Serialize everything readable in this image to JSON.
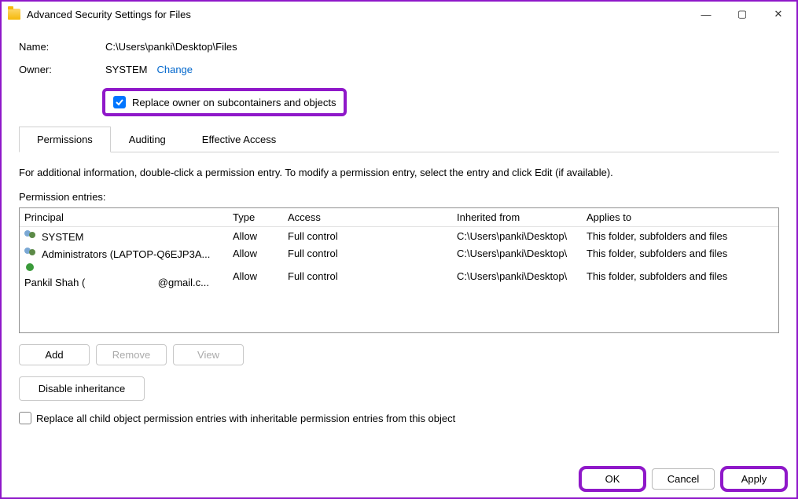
{
  "window": {
    "title": "Advanced Security Settings for Files"
  },
  "info": {
    "name_label": "Name:",
    "name_value": "C:\\Users\\panki\\Desktop\\Files",
    "owner_label": "Owner:",
    "owner_value": "SYSTEM",
    "change_link": "Change",
    "replace_owner_label": "Replace owner on subcontainers and objects"
  },
  "tabs": {
    "permissions": "Permissions",
    "auditing": "Auditing",
    "effective": "Effective Access"
  },
  "body": {
    "instructions": "For additional information, double-click a permission entry. To modify a permission entry, select the entry and click Edit (if available).",
    "entries_label": "Permission entries:",
    "headers": {
      "principal": "Principal",
      "type": "Type",
      "access": "Access",
      "inherited": "Inherited from",
      "applies": "Applies to"
    },
    "rows": [
      {
        "principal": "SYSTEM",
        "type": "Allow",
        "access": "Full control",
        "inherited": "C:\\Users\\panki\\Desktop\\",
        "applies": "This folder, subfolders and files",
        "icon": "group"
      },
      {
        "principal": "Administrators (LAPTOP-Q6EJP3A...",
        "type": "Allow",
        "access": "Full control",
        "inherited": "C:\\Users\\panki\\Desktop\\",
        "applies": "This folder, subfolders and files",
        "icon": "group"
      },
      {
        "principal": "Pankil Shah (",
        "principal_suffix": "@gmail.c...",
        "type": "Allow",
        "access": "Full control",
        "inherited": "C:\\Users\\panki\\Desktop\\",
        "applies": "This folder, subfolders and files",
        "icon": "user"
      }
    ],
    "buttons": {
      "add": "Add",
      "remove": "Remove",
      "view": "View",
      "disable": "Disable inheritance",
      "replace_all": "Replace all child object permission entries with inheritable permission entries from this object"
    }
  },
  "footer": {
    "ok": "OK",
    "cancel": "Cancel",
    "apply": "Apply"
  }
}
